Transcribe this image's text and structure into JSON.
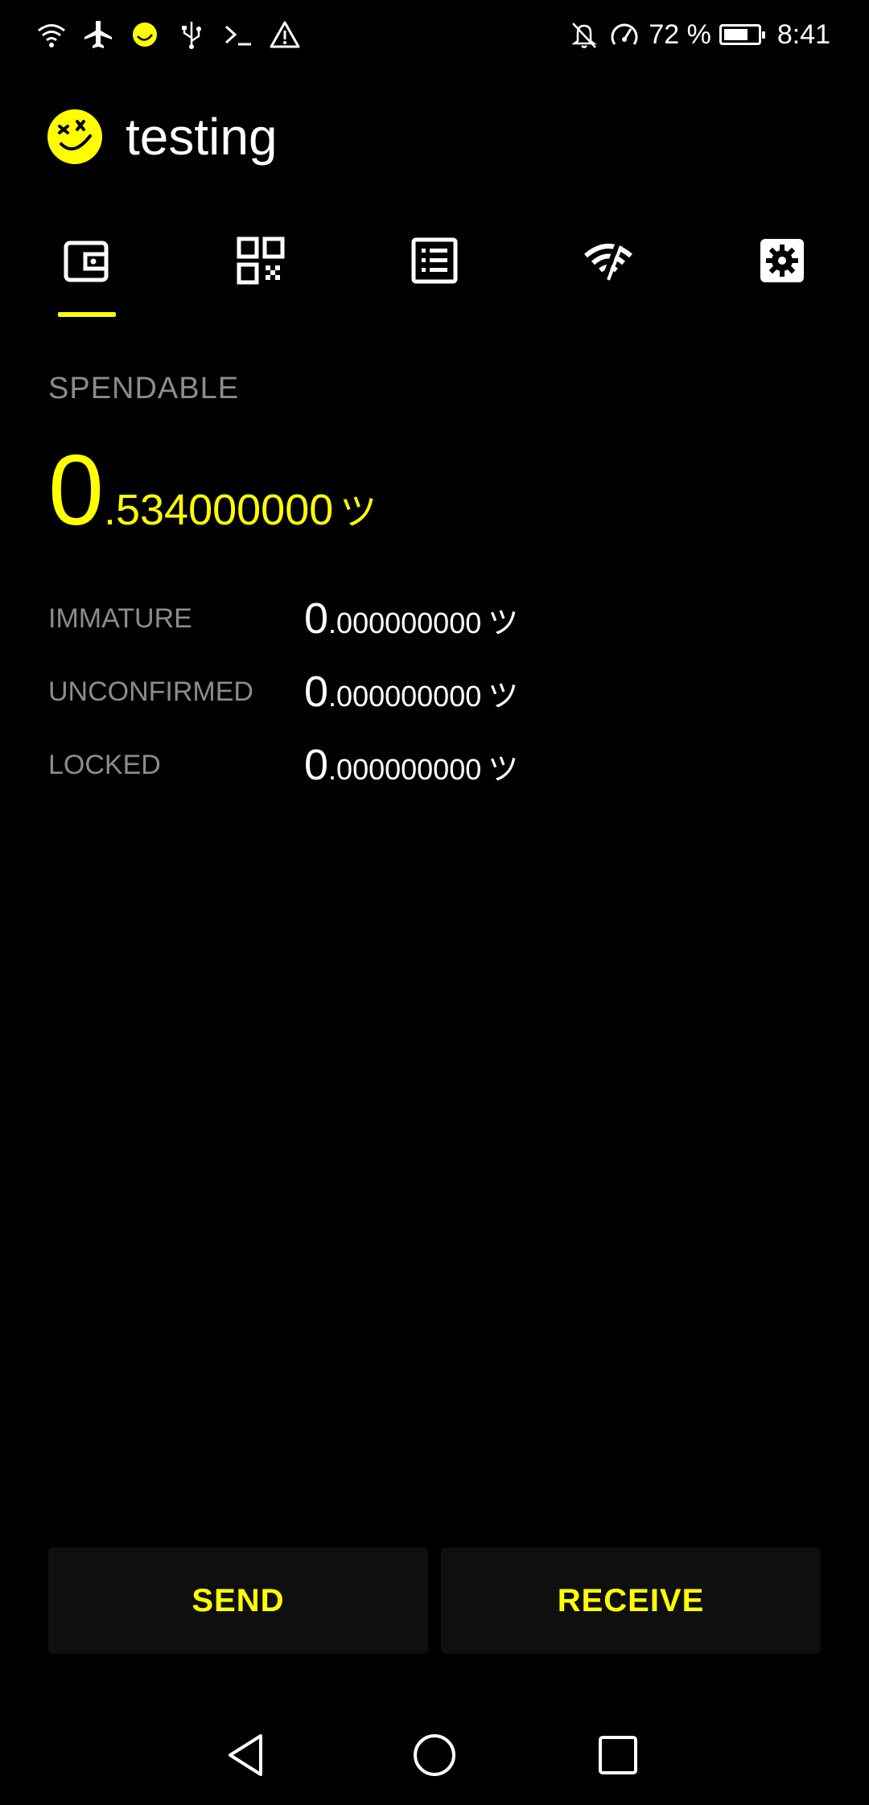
{
  "status_bar": {
    "battery_percent": "72 %",
    "battery_level": 0.72,
    "time": "8:41",
    "left_icons": [
      "wifi-icon",
      "airplane-icon",
      "app-smiley-icon",
      "usb-icon",
      "terminal-icon",
      "warning-icon"
    ],
    "right_icons": [
      "notifications-off-icon",
      "speedometer-icon",
      "battery-charging-icon"
    ]
  },
  "header": {
    "title": "testing",
    "logo_icon": "smiley-logo-icon"
  },
  "tabs": [
    {
      "name": "wallet",
      "icon": "wallet-icon",
      "active": true
    },
    {
      "name": "qr-code",
      "icon": "qr-code-icon",
      "active": false
    },
    {
      "name": "transactions",
      "icon": "list-icon",
      "active": false
    },
    {
      "name": "network",
      "icon": "wifi-off-icon",
      "active": false
    },
    {
      "name": "settings",
      "icon": "gear-icon",
      "active": false
    }
  ],
  "balances": {
    "spendable_label": "SPENDABLE",
    "spendable_int": "0",
    "spendable_frac": ".534000000",
    "unit": "ツ",
    "rows": [
      {
        "label": "IMMATURE",
        "int": "0",
        "frac": ".000000000",
        "unit": "ツ"
      },
      {
        "label": "UNCONFIRMED",
        "int": "0",
        "frac": ".000000000",
        "unit": "ツ"
      },
      {
        "label": "LOCKED",
        "int": "0",
        "frac": ".000000000",
        "unit": "ツ"
      }
    ]
  },
  "actions": {
    "send_label": "SEND",
    "receive_label": "RECEIVE"
  },
  "colors": {
    "accent": "#ffff00",
    "background": "#000000",
    "muted_text": "#8c8c8c",
    "button_bg": "#0f0f0f"
  },
  "nav_bar": {
    "buttons": [
      "back-icon",
      "home-icon",
      "recents-icon"
    ]
  }
}
